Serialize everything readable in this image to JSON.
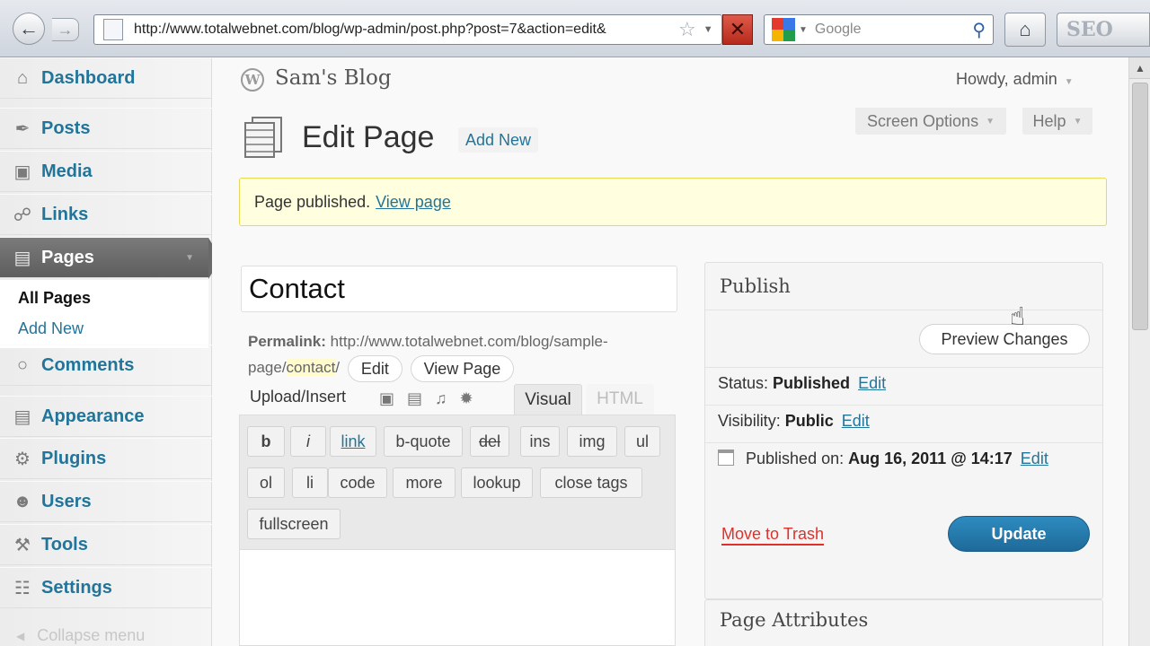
{
  "browser": {
    "back_icon": "back-arrow-icon",
    "forward_icon": "forward-arrow-icon",
    "url": "http://www.totalwebnet.com/blog/wp-admin/post.php?post=7&action=edit&",
    "search_placeholder": "Google",
    "seo_label": "SEO"
  },
  "sidebar": {
    "items": [
      {
        "label": "Dashboard",
        "icon": "dashboard-icon"
      },
      {
        "label": "Posts",
        "icon": "pin-icon"
      },
      {
        "label": "Media",
        "icon": "media-icon"
      },
      {
        "label": "Links",
        "icon": "link-icon"
      },
      {
        "label": "Pages",
        "icon": "pages-icon"
      },
      {
        "label": "Comments",
        "icon": "comment-icon"
      },
      {
        "label": "Appearance",
        "icon": "appearance-icon"
      },
      {
        "label": "Plugins",
        "icon": "plugin-icon"
      },
      {
        "label": "Users",
        "icon": "users-icon"
      },
      {
        "label": "Tools",
        "icon": "tools-icon"
      },
      {
        "label": "Settings",
        "icon": "settings-icon"
      }
    ],
    "submenu": {
      "all_pages": "All Pages",
      "add_new": "Add New"
    },
    "collapse_label": "Collapse menu"
  },
  "header": {
    "site_title": "Sam's Blog",
    "howdy": "Howdy, admin",
    "screen_options": "Screen Options",
    "help": "Help"
  },
  "page": {
    "heading": "Edit Page",
    "add_new": "Add New",
    "notice_text": "Page published.",
    "notice_link": "View page"
  },
  "editor": {
    "title_value": "Contact",
    "permalink_label": "Permalink:",
    "permalink_base": "http://www.totalwebnet.com/blog/sample-page/",
    "permalink_slug": "contact",
    "permalink_end": "/",
    "edit_btn": "Edit",
    "view_page_btn": "View Page",
    "upload_insert": "Upload/Insert",
    "tab_visual": "Visual",
    "tab_html": "HTML",
    "quicktags": [
      "b",
      "i",
      "link",
      "b-quote",
      "del",
      "ins",
      "img",
      "ul",
      "ol",
      "li",
      "code",
      "more",
      "lookup",
      "close tags",
      "fullscreen"
    ]
  },
  "publish": {
    "title": "Publish",
    "preview_btn": "Preview Changes",
    "status_label": "Status:",
    "status_value": "Published",
    "visibility_label": "Visibility:",
    "visibility_value": "Public",
    "published_on_label": "Published on:",
    "published_on_value": "Aug 16, 2011 @ 14:17",
    "edit_link": "Edit",
    "trash_link": "Move to Trash",
    "update_btn": "Update"
  },
  "attributes": {
    "title": "Page Attributes"
  },
  "colors": {
    "wp_link": "#21759b",
    "trash": "#e0302a",
    "update": "#2e8bc0",
    "notice_bg": "#ffffe0"
  }
}
